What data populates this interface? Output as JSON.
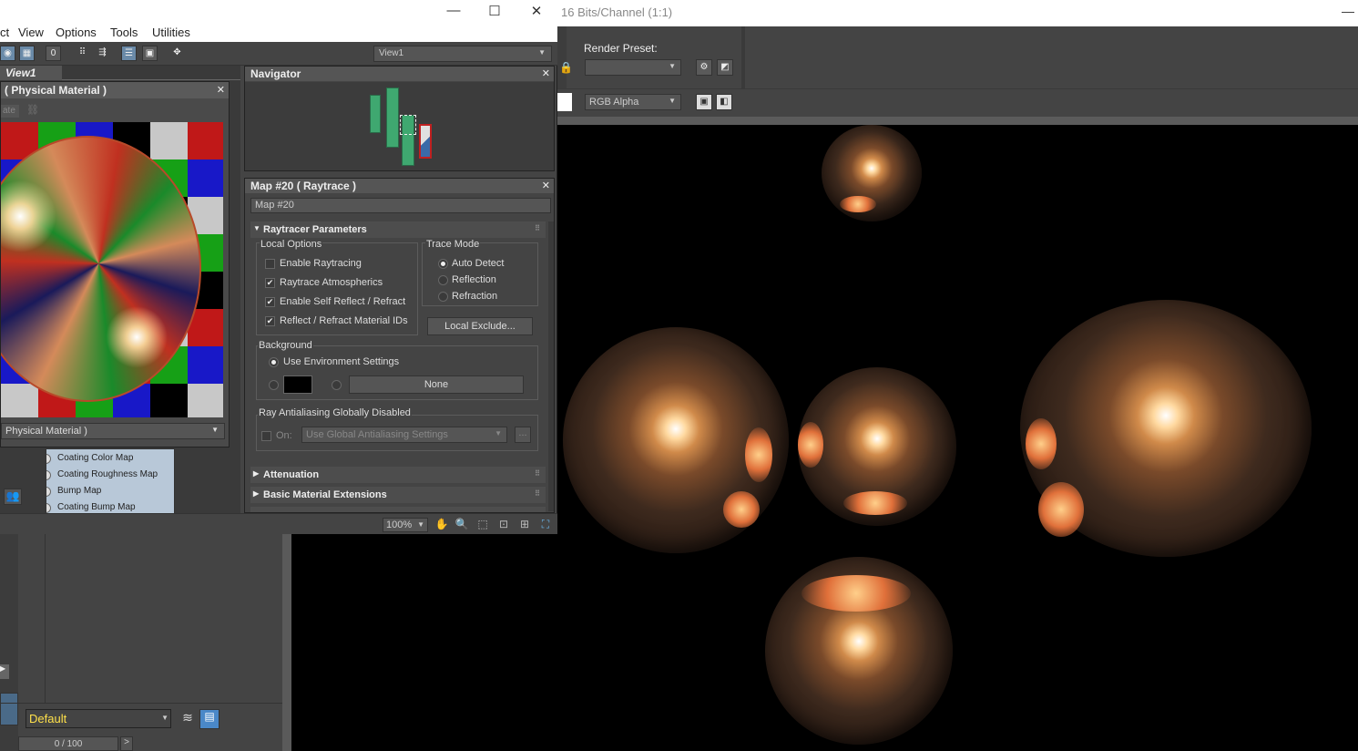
{
  "render_window": {
    "title": "16 Bits/Channel (1:1)",
    "render_preset_label": "Render Preset:",
    "render_preset_value": "",
    "channel_value": "RGB Alpha"
  },
  "material_editor": {
    "menu": [
      "ct",
      "View",
      "Options",
      "Tools",
      "Utilities"
    ],
    "view_select": "View1",
    "view_tab": "View1",
    "node_title": "( Physical Material )",
    "node_sub_label": "ate",
    "node_dropdown": "Physical Material )",
    "map_slots": [
      "Coating Color Map",
      "Coating Roughness Map",
      "Bump Map",
      "Coating Bump Map"
    ],
    "navigator_title": "Navigator",
    "map_panel_title": "Map #20  ( Raytrace )",
    "map_name": "Map #20",
    "raytracer": {
      "title": "Raytracer Parameters",
      "local_options_label": "Local Options",
      "options": [
        {
          "label": "Enable Raytracing",
          "checked": false
        },
        {
          "label": "Raytrace Atmospherics",
          "checked": true
        },
        {
          "label": "Enable Self Reflect / Refract",
          "checked": true
        },
        {
          "label": "Reflect / Refract Material IDs",
          "checked": true
        }
      ],
      "trace_mode_label": "Trace Mode",
      "trace_modes": [
        {
          "label": "Auto Detect",
          "selected": true
        },
        {
          "label": "Reflection",
          "selected": false
        },
        {
          "label": "Refraction",
          "selected": false
        }
      ],
      "local_exclude": "Local Exclude...",
      "background_label": "Background",
      "use_env": "Use Environment Settings",
      "none_button": "None",
      "antialias_label": "Ray Antialiasing Globally Disabled",
      "on_label": "On:",
      "antialias_value": "Use Global Antialiasing Settings",
      "ellipsis": "..."
    },
    "rollouts": [
      "Attenuation",
      "Basic Material Extensions"
    ],
    "zoom": "100%"
  },
  "main_app": {
    "layer_value": "Default",
    "time_slider": "0 / 100"
  }
}
